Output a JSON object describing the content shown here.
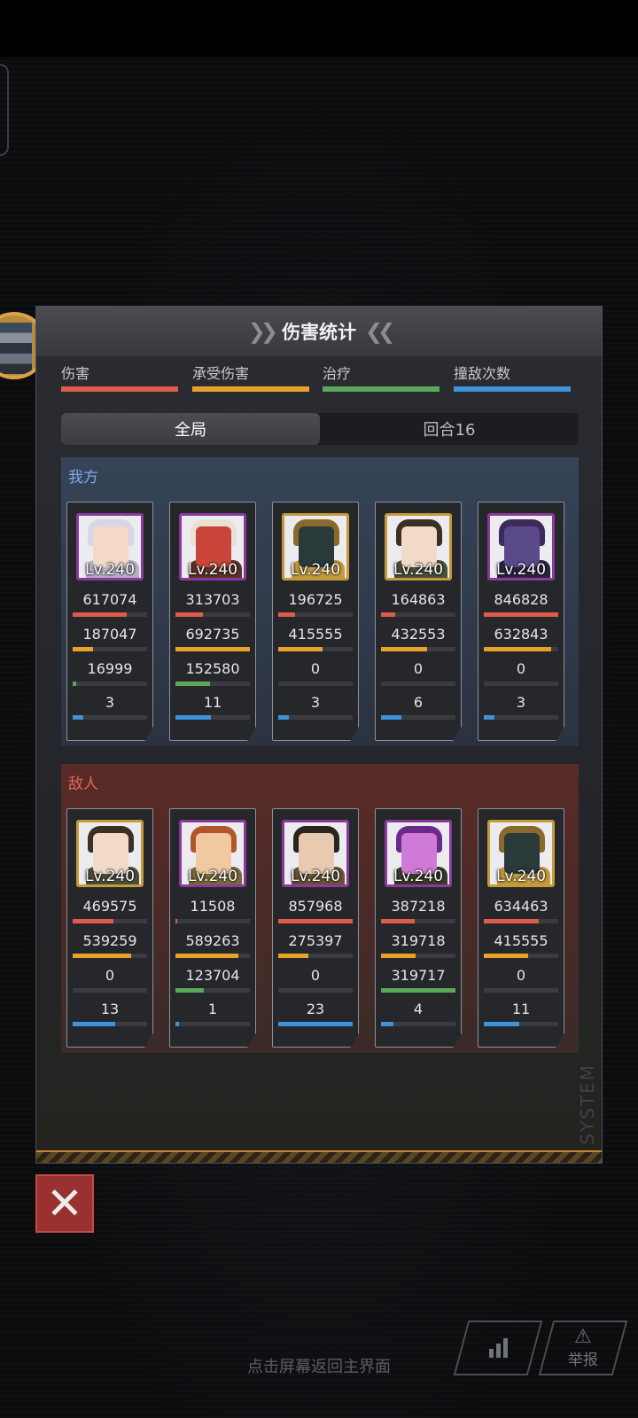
{
  "header": {
    "title": "伤害统计"
  },
  "legend": [
    {
      "label": "伤害",
      "color": "#e05a4c"
    },
    {
      "label": "承受伤害",
      "color": "#e8a22a"
    },
    {
      "label": "治疗",
      "color": "#5aa85a"
    },
    {
      "label": "撞敌次数",
      "color": "#3f93d8"
    }
  ],
  "tabs": [
    {
      "label": "全局",
      "active": true
    },
    {
      "label": "回合16",
      "active": false
    }
  ],
  "ally": {
    "title": "我方",
    "units": [
      {
        "level": "Lv.240",
        "damage": "617074",
        "taken": "187047",
        "heal": "16999",
        "hits": "3",
        "fill": [
          0.73,
          0.27,
          0.05,
          0.14
        ],
        "palette": [
          "#d9d6e6",
          "#f3d9c6",
          "#b4b0c6"
        ],
        "border": "#8a3a9a"
      },
      {
        "level": "Lv.240",
        "damage": "313703",
        "taken": "692735",
        "heal": "152580",
        "hits": "11",
        "fill": [
          0.37,
          1.0,
          0.47,
          0.48
        ],
        "palette": [
          "#e8e2d4",
          "#c9453a",
          "#5a3326"
        ],
        "border": "#8a3a9a"
      },
      {
        "level": "Lv.240",
        "damage": "196725",
        "taken": "415555",
        "heal": "0",
        "hits": "3",
        "fill": [
          0.23,
          0.6,
          0.0,
          0.14
        ],
        "palette": [
          "#8a6a2a",
          "#2a3a3a",
          "#c49a3a"
        ],
        "border": "#c49a3a"
      },
      {
        "level": "Lv.240",
        "damage": "164863",
        "taken": "432553",
        "heal": "0",
        "hits": "6",
        "fill": [
          0.19,
          0.62,
          0.0,
          0.27
        ],
        "palette": [
          "#3a3026",
          "#f1dbc8",
          "#4a4f3a"
        ],
        "border": "#c49a3a"
      },
      {
        "level": "Lv.240",
        "damage": "846828",
        "taken": "632843",
        "heal": "0",
        "hits": "3",
        "fill": [
          1.0,
          0.91,
          0.0,
          0.14
        ],
        "palette": [
          "#3c2a5a",
          "#5a4a8a",
          "#2a2440"
        ],
        "border": "#8a3a9a"
      }
    ]
  },
  "enemy": {
    "title": "敌人",
    "units": [
      {
        "level": "Lv.240",
        "damage": "469575",
        "taken": "539259",
        "heal": "0",
        "hits": "13",
        "fill": [
          0.55,
          0.78,
          0.0,
          0.57
        ],
        "palette": [
          "#3a3026",
          "#f1dbc8",
          "#4a4f3a"
        ],
        "border": "#c49a3a"
      },
      {
        "level": "Lv.240",
        "damage": "11508",
        "taken": "589263",
        "heal": "123704",
        "hits": "1",
        "fill": [
          0.02,
          0.85,
          0.38,
          0.05
        ],
        "palette": [
          "#b0562a",
          "#f0c9a0",
          "#7a6a3a"
        ],
        "border": "#8a3a9a"
      },
      {
        "level": "Lv.240",
        "damage": "857968",
        "taken": "275397",
        "heal": "0",
        "hits": "23",
        "fill": [
          1.0,
          0.4,
          0.0,
          1.0
        ],
        "palette": [
          "#2a241e",
          "#e8cab0",
          "#6a5232"
        ],
        "border": "#8a3a9a"
      },
      {
        "level": "Lv.240",
        "damage": "387218",
        "taken": "319718",
        "heal": "319717",
        "hits": "4",
        "fill": [
          0.45,
          0.46,
          1.0,
          0.17
        ],
        "palette": [
          "#6a2a8a",
          "#d07ad8",
          "#3a3a2a"
        ],
        "border": "#8a3a9a"
      },
      {
        "level": "Lv.240",
        "damage": "634463",
        "taken": "415555",
        "heal": "0",
        "hits": "11",
        "fill": [
          0.74,
          0.6,
          0.0,
          0.48
        ],
        "palette": [
          "#8a6a2a",
          "#2a3a3a",
          "#c49a3a"
        ],
        "border": "#c49a3a"
      }
    ]
  },
  "footer": {
    "system_label": "SYSTEM",
    "close_label": "✕",
    "hint": "点击屏幕返回主界面",
    "report_label": "举报"
  }
}
